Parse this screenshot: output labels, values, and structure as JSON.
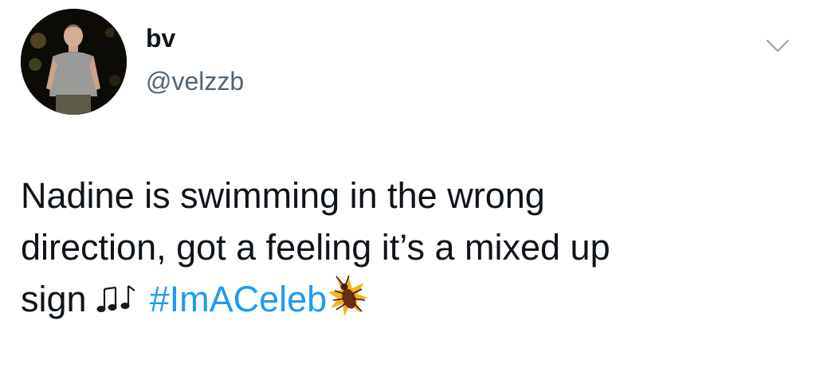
{
  "tweet": {
    "author": {
      "display_name": "bv",
      "handle": "@velzzb",
      "avatar_icon": "profile-photo-icon"
    },
    "menu_icon": "chevron-down-icon",
    "text": {
      "line1": "Nadine is swimming in the wrong",
      "line2": "direction, got a feeling it’s a mixed up",
      "line3_word": "sign",
      "music_icon": "musical-notes-icon",
      "hashtag": "#ImACeleb",
      "hashtag_icon": "cockroach-icon"
    }
  },
  "colors": {
    "text": "#0f1419",
    "secondary_text": "#536471",
    "hashtag": "#1d9bf0",
    "background": "#ffffff"
  }
}
